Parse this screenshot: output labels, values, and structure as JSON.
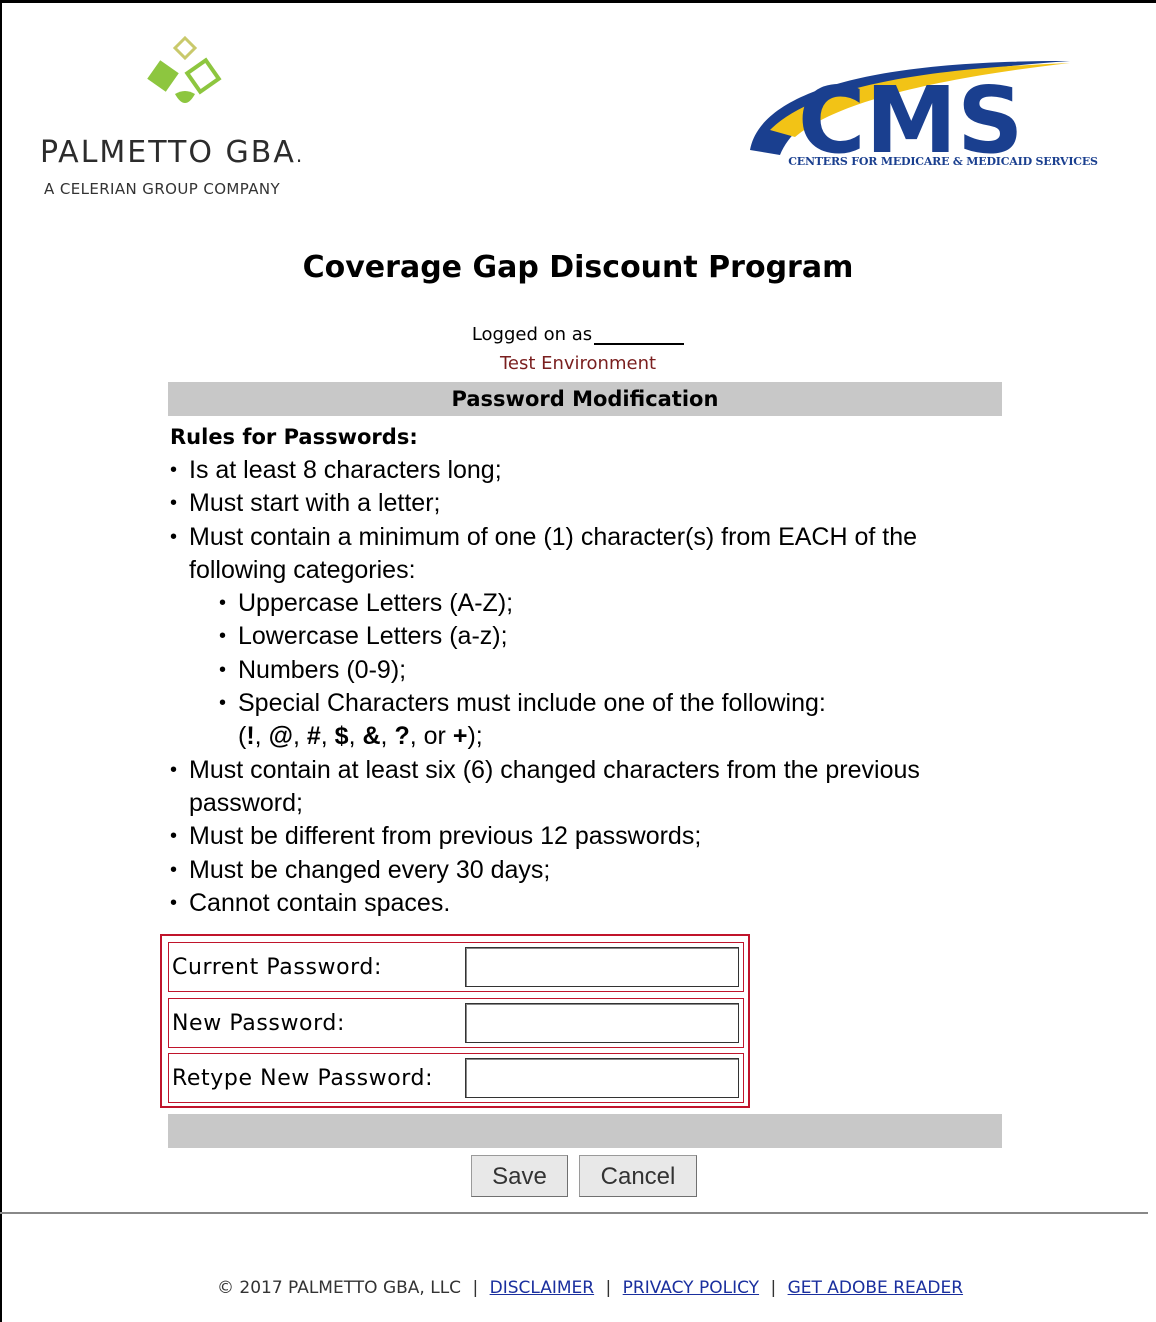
{
  "brand": {
    "pgba_name": "PALMETTO GBA",
    "pgba_reg": ".",
    "pgba_tagline": "A CELERIAN GROUP COMPANY",
    "cms_letters": "CMS",
    "cms_tagline": "CENTERS FOR MEDICARE & MEDICAID SERVICES",
    "colors": {
      "pgba_green": "#8dc63f",
      "cms_blue": "#1a3f8f",
      "cms_gold": "#f2c316"
    }
  },
  "header": {
    "title": "Coverage Gap Discount Program",
    "logged_on_label": "Logged on as",
    "environment": "Test Environment"
  },
  "section": {
    "title": "Password Modification"
  },
  "rules": {
    "heading": "Rules for Passwords:",
    "r1": "Is at least 8 characters long;",
    "r2": "Must start with a letter;",
    "r3a": "Must contain a minimum of one (1) character(s) from EACH of the",
    "r3b": "following categories:",
    "s1": "Uppercase Letters (A-Z);",
    "s2": "Lowercase Letters (a-z);",
    "s3": "Numbers (0-9);",
    "s4": "Special Characters must include one of the following:",
    "s4_chars": [
      "!",
      "@",
      "#",
      "$",
      "&",
      "?",
      "+"
    ],
    "s4_open": "(",
    "s4_or": "or",
    "s4_close": ");",
    "r4a": "Must contain at least six (6) changed characters from the previous",
    "r4b": "password;",
    "r5": "Must be different from previous 12 passwords;",
    "r6": "Must be changed every 30 days;",
    "r7": "Cannot contain spaces."
  },
  "form": {
    "current_label": "Current Password:",
    "current_value": "",
    "new_label": "New Password:",
    "new_value": "",
    "retype_label": "Retype New Password:",
    "retype_value": ""
  },
  "buttons": {
    "save": "Save",
    "cancel": "Cancel"
  },
  "footer": {
    "copyright": "© 2017 PALMETTO GBA, LLC",
    "sep": "|",
    "disclaimer": "DISCLAIMER",
    "privacy": "PRIVACY POLICY",
    "adobe": "GET ADOBE READER"
  }
}
